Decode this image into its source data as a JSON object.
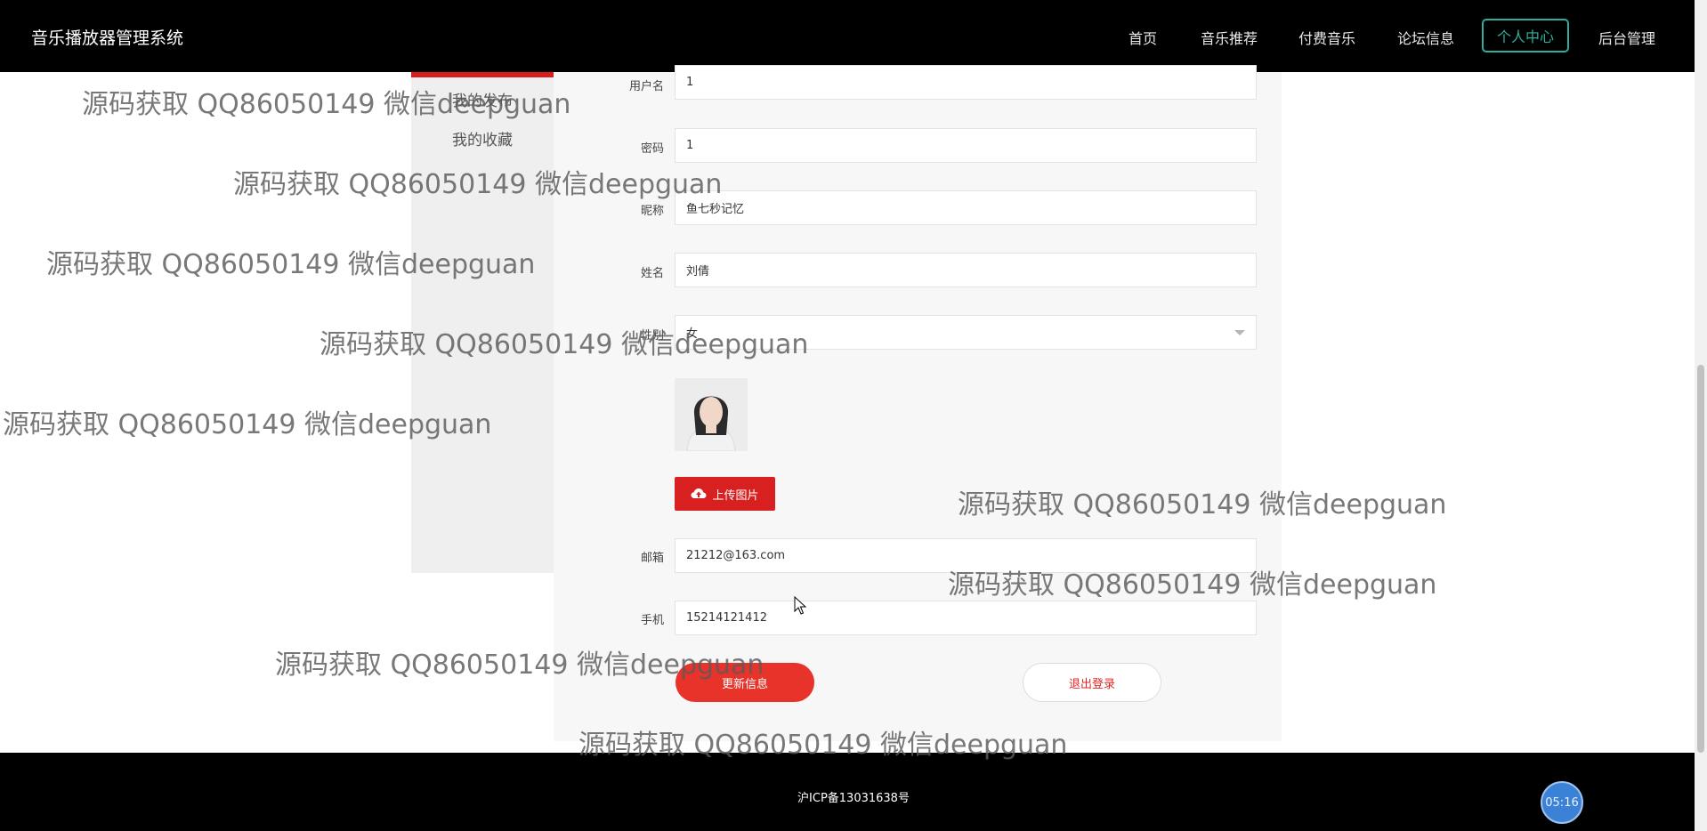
{
  "header": {
    "brand": "音乐播放器管理系统",
    "nav": [
      "首页",
      "音乐推荐",
      "付费音乐",
      "论坛信息",
      "个人中心",
      "后台管理"
    ],
    "active": "个人中心"
  },
  "sidebar": {
    "items": [
      "我的发布",
      "我的收藏"
    ]
  },
  "form": {
    "username_label": "用户名",
    "username_value": "1",
    "password_label": "密码",
    "password_value": "1",
    "nickname_label": "昵称",
    "nickname_value": "鱼七秒记忆",
    "name_label": "姓名",
    "name_value": "刘倩",
    "gender_label": "性别",
    "gender_value": "女",
    "upload_label": "上传图片",
    "email_label": "邮箱",
    "email_value": "21212@163.com",
    "phone_label": "手机",
    "phone_value": "15214121412",
    "update_label": "更新信息",
    "logout_label": "退出登录"
  },
  "footer": {
    "icp": "沪ICP备13031638号",
    "timer": "05:16"
  },
  "watermark": {
    "text": "源码获取 QQ86050149 微信deepguan"
  },
  "colors": {
    "accent_red": "#d92020",
    "active_nav": "#2fae9b",
    "timer_blue": "#3b82d6"
  }
}
